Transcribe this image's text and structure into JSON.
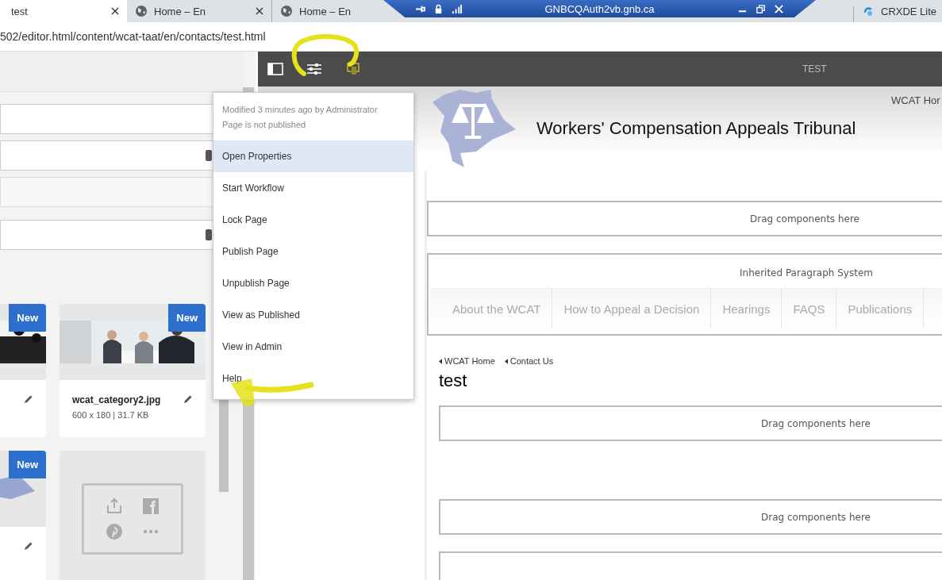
{
  "browser": {
    "tabs": [
      {
        "title": "test",
        "selected": true
      },
      {
        "title": "Home – En",
        "selected": false
      },
      {
        "title": "Home – En",
        "selected": false
      },
      {
        "title": "CRXDE Lite",
        "selected": false
      }
    ],
    "remote_bar": {
      "title": "GNBCQAuth2vb.gnb.ca"
    },
    "address": "502/editor.html/content/wcat-taat/en/contacts/test.html"
  },
  "side_panel": {
    "assets": [
      {
        "badge": "New",
        "kind": "silhouettes"
      },
      {
        "name": "wcat_category2.jpg",
        "meta": "600 x 180 | 31.7 KB",
        "badge": "New",
        "kind": "meeting"
      },
      {
        "badge": "New",
        "kind": "logo"
      },
      {
        "kind": "share"
      }
    ]
  },
  "toolbar": {
    "page_title": "TEST"
  },
  "page_menu": {
    "info": [
      "Modified 3 minutes ago by Administrator",
      "Page is not published"
    ],
    "items": [
      {
        "label": "Open Properties",
        "selected": true
      },
      {
        "label": "Start Workflow",
        "selected": false
      },
      {
        "label": "Lock Page",
        "selected": false
      },
      {
        "label": "Publish Page",
        "selected": false
      },
      {
        "label": "Unpublish Page",
        "selected": false
      },
      {
        "label": "View as Published",
        "selected": false
      },
      {
        "label": "View in Admin",
        "selected": false
      },
      {
        "label": "Help",
        "selected": false
      }
    ]
  },
  "preview": {
    "top_link": "WCAT Hor",
    "site_title": "Workers' Compensation Appeals Tribunal",
    "drop_zone_1": "Drag components here",
    "inherited_label": "Inherited Paragraph System",
    "nav": [
      "About the WCAT",
      "How to Appeal a Decision",
      "Hearings",
      "FAQS",
      "Publications"
    ],
    "breadcrumbs": [
      "WCAT Home",
      "Contact Us"
    ],
    "heading": "test",
    "drop_zones": [
      "Drag components here",
      "Drag components here"
    ]
  }
}
